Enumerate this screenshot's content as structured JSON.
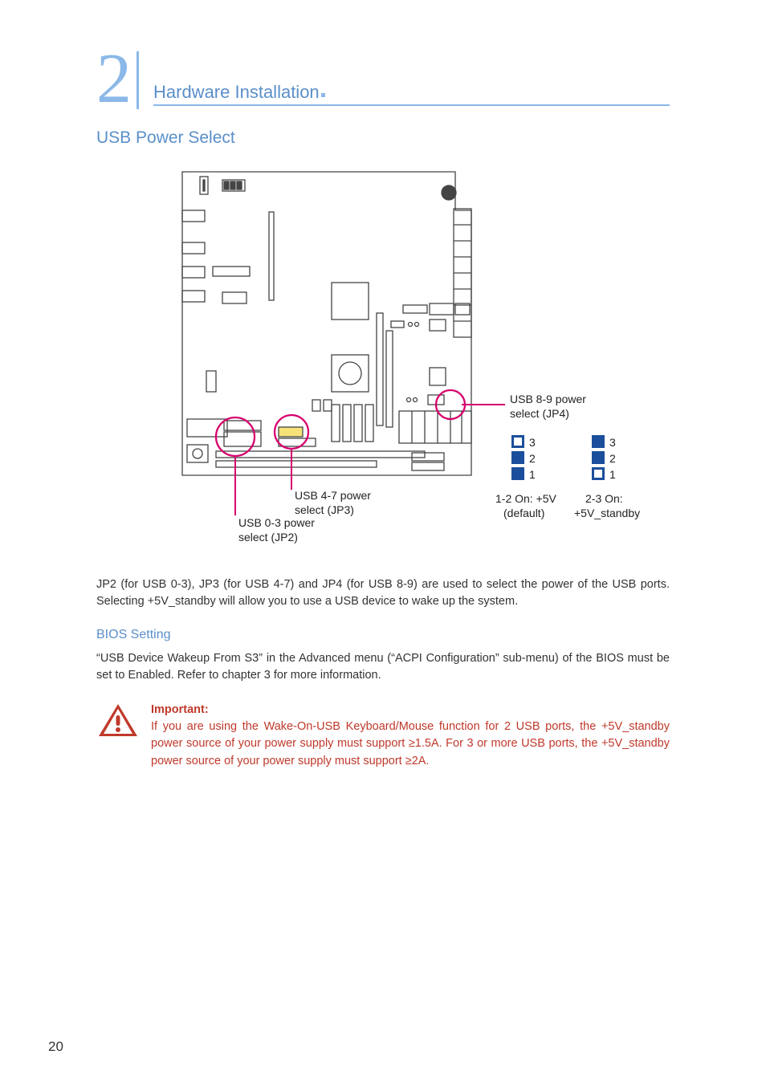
{
  "chapter_number": "2",
  "chapter_title": "Hardware Installation",
  "section_title": "USB Power Select",
  "diagram": {
    "callouts": {
      "usb89": "USB 8-9 power select (JP4)",
      "usb47": "USB 4-7 power select (JP3)",
      "usb03": "USB 0-3 power select (JP2)"
    },
    "jumper_pins": [
      "3",
      "2",
      "1"
    ],
    "jumper_left_caption_l1": "1-2 On: +5V",
    "jumper_left_caption_l2": "(default)",
    "jumper_right_caption_l1": "2-3 On:",
    "jumper_right_caption_l2": "+5V_standby"
  },
  "body_paragraph": "JP2 (for USB 0-3), JP3 (for USB 4-7) and JP4 (for USB 8-9) are used to select the power of the USB ports. Selecting +5V_standby will allow you to use a USB device to wake up the system.",
  "bios_heading": "BIOS Setting",
  "bios_paragraph": "“USB Device Wakeup From S3” in the Advanced menu (“ACPI Configuration” sub-menu) of the BIOS must be set to Enabled. Refer to chapter 3 for more information.",
  "important_label": "Important:",
  "important_text": "If you are using the Wake-On-USB Keyboard/Mouse function for 2 USB ports, the +5V_standby power source of your power supply must support ≥1.5A. For 3 or more USB ports, the +5V_standby power source of your power supply must support ≥2A.",
  "page_number": "20"
}
